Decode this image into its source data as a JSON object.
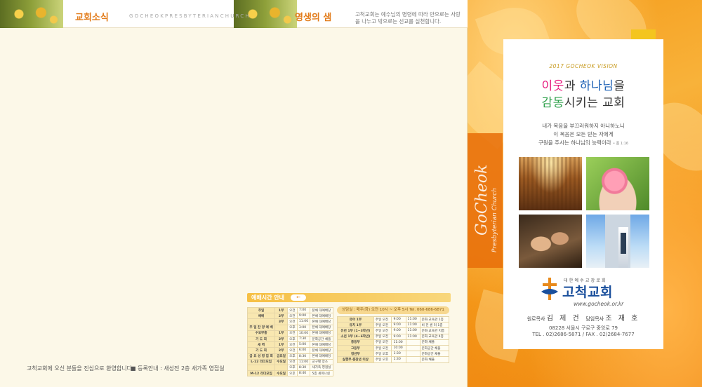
{
  "left_panel": {
    "section1_title": "교회소식",
    "section1_subtitle": "GOCHEOKPRESBYTERIANCHURCH",
    "section2_title": "영생의 샘",
    "section2_desc": "고척교회는 예수님의 명령에 따라 만으로는 사랑을 나누고 밖으로는 선교를 실천합니다.",
    "welcome_text": "고척교회에 오신 분들을 진심으로 환영합니다",
    "register_text": "■ 등록안내 : 새성전 2층 새가족 영접실",
    "schedule_title": "예배시간 안내",
    "schedule_arrow": "←",
    "counsel_notice": "상담실 : 매주(화) 오전 10시 ~ 오후 5시   Tel. 060-686-6871",
    "schedule_left": [
      [
        "주일",
        "1부",
        "오전",
        "7:00",
        "본채 대예배당"
      ],
      [
        "예배",
        "2부",
        "오전",
        "9:00",
        "본채 대예배당"
      ],
      [
        "",
        "3부",
        "오전",
        "11:00",
        "본채 대예배당"
      ],
      [
        "주 일 찬 양 예 배",
        "",
        "오후",
        "3:00",
        "본채 대예배당"
      ],
      [
        "수요부흥",
        "1부",
        "오전",
        "10:00",
        "본채 대예배당"
      ],
      [
        "기 도 회",
        "2부",
        "오후",
        "7:30",
        "문화공간 채플"
      ],
      [
        "새    벽",
        "1부",
        "오전",
        "5:00",
        "본채 대예배당"
      ],
      [
        "기 도 회",
        "2부",
        "오전",
        "6:00",
        "본채 대예배당"
      ],
      [
        "금 요 성 령 집 회",
        "금요일",
        "오후",
        "8:30",
        "본채 대예배당"
      ],
      [
        "L-12 리더모임",
        "수요일",
        "오전",
        "11:00",
        "교구별 장소"
      ],
      [
        "",
        "",
        "오후",
        "8:30",
        "새가족 영접실"
      ],
      [
        "M-12 리더모임",
        "수요일",
        "오후",
        "8:40",
        "5층 세미나실"
      ]
    ],
    "schedule_right": [
      [
        "유아 1부",
        "주일 오전",
        "9:00",
        "11:00",
        "문화 교육관 1층"
      ],
      [
        "유치 1부",
        "주일 오전",
        "9:00",
        "11:00",
        "비 전 센 터 1층"
      ],
      [
        "유년 1부 (1~3학년)",
        "주일 오전",
        "9:00",
        "11:00",
        "문화 교육관 지층"
      ],
      [
        "소년 1부 (4~6학년)",
        "주일 오전",
        "9:00",
        "11:00",
        "문화 교육관 4층"
      ],
      [
        "중등부",
        "주일 오전",
        "11:00",
        "",
        "문화 채플"
      ],
      [
        "고등부",
        "주일 오전",
        "10:00",
        "",
        "문화공간 채플"
      ],
      [
        "청년부",
        "주일 오후",
        "1:30",
        "",
        "문화공간 채플"
      ],
      [
        "실행부·중장년 이상",
        "주일 오후",
        "1:30",
        "",
        "문화 채플"
      ]
    ]
  },
  "cover": {
    "brand_main": "GoCheok",
    "brand_sub": "Presbyterian Church",
    "vision": "2017 GOCHEOK VISION",
    "slogan_1a": "이웃",
    "slogan_1b": "과 ",
    "slogan_1c": "하나님",
    "slogan_1d": "을",
    "slogan_2a": "감동",
    "slogan_2b": "시키는 교회",
    "verse_1": "내가 복음을 부끄러워하지 아니하노니",
    "verse_2": "이 복음은 모든 믿는 자에게",
    "verse_3": "구원을 주시는 하나님의 능력이라",
    "verse_ref": "• 롬 1:16",
    "denomination": "대한예수교장로회",
    "church_name": "고척교회",
    "url": "www.gocheok.or.kr",
    "pastor_emeritus_label": "원로목사",
    "pastor_emeritus_name": "김 제 건",
    "pastor_label": "담임목사",
    "pastor_name": "조 재 호",
    "address": "08228 서울시 구로구 중앙로 79",
    "phone": "TEL . 02)2686-5871 / FAX . 02)2684-7677",
    "accent_colors": {
      "orange": "#f39316",
      "pink": "#e6177d",
      "blue": "#1a5fb4",
      "green": "#2da04a"
    }
  }
}
